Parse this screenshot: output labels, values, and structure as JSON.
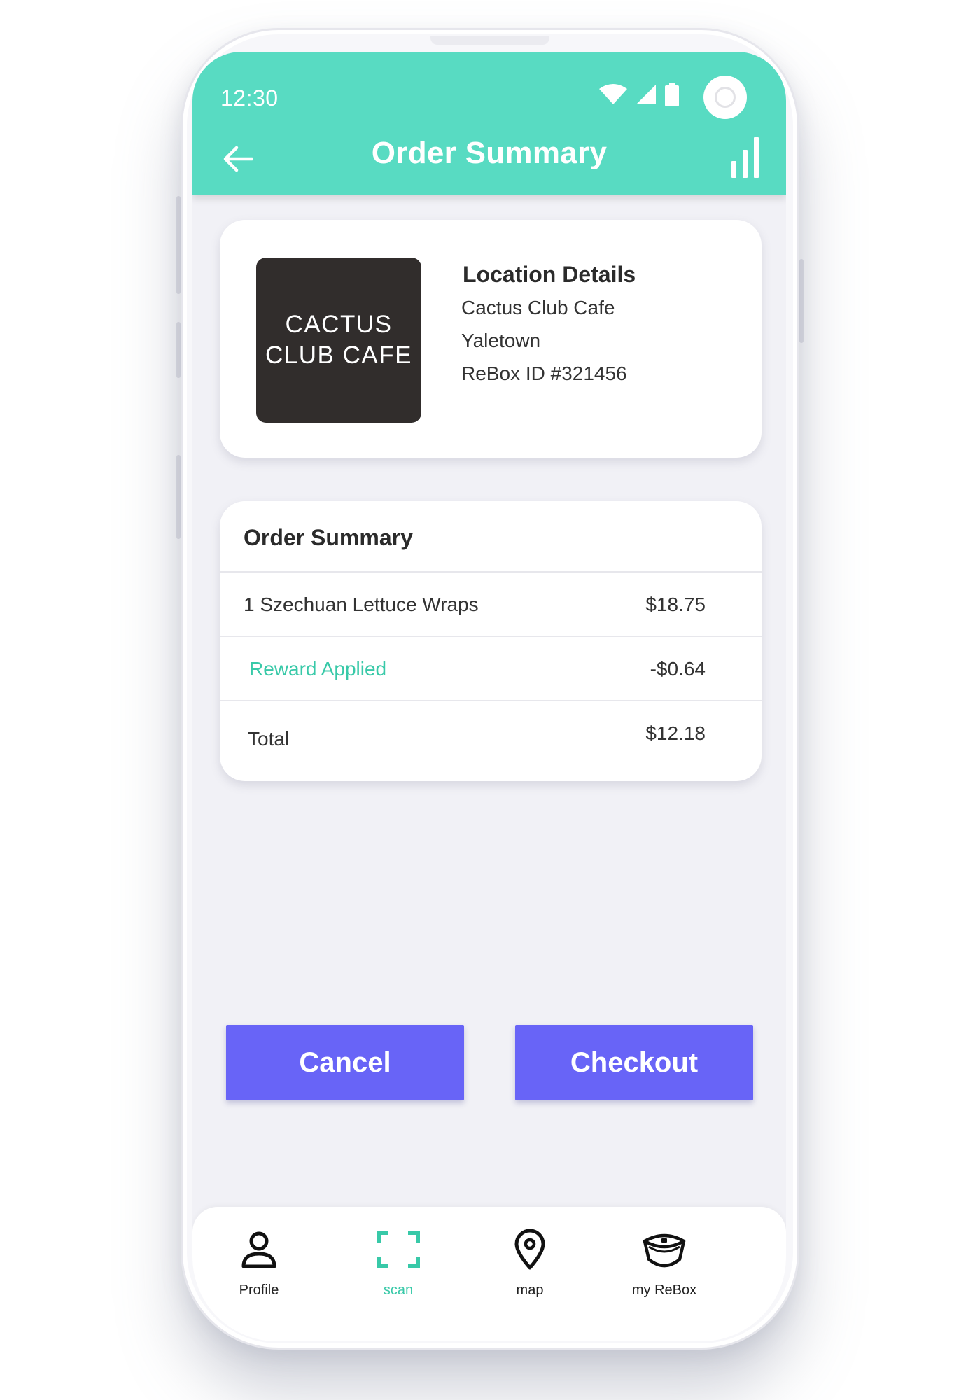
{
  "status_bar": {
    "time": "12:30"
  },
  "appbar": {
    "title": "Order Summary"
  },
  "location": {
    "logo_line1": "CACTUS",
    "logo_line2": "CLUB CAFE",
    "heading": "Location Details",
    "name": "Cactus Club Cafe",
    "area": "Yaletown",
    "rebox_id": "ReBox ID #321456"
  },
  "order": {
    "heading": "Order Summary",
    "items": [
      {
        "label": "1 Szechuan Lettuce Wraps",
        "value": "$18.75"
      },
      {
        "label": "Reward Applied",
        "value": "-$0.64"
      },
      {
        "label": "Total",
        "value": "$12.18"
      }
    ]
  },
  "actions": {
    "cancel_label": "Cancel",
    "checkout_label": "Checkout"
  },
  "nav": {
    "items": [
      {
        "label": "Profile",
        "icon": "person-icon"
      },
      {
        "label": "scan",
        "icon": "scan-icon",
        "active": true
      },
      {
        "label": "map",
        "icon": "map-pin-icon"
      },
      {
        "label": "my ReBox",
        "icon": "box-icon"
      }
    ]
  },
  "colors": {
    "accent": "#58dbc2",
    "reward": "#38c9a8",
    "button": "#6864f7",
    "logo_bg": "#312d2c"
  }
}
